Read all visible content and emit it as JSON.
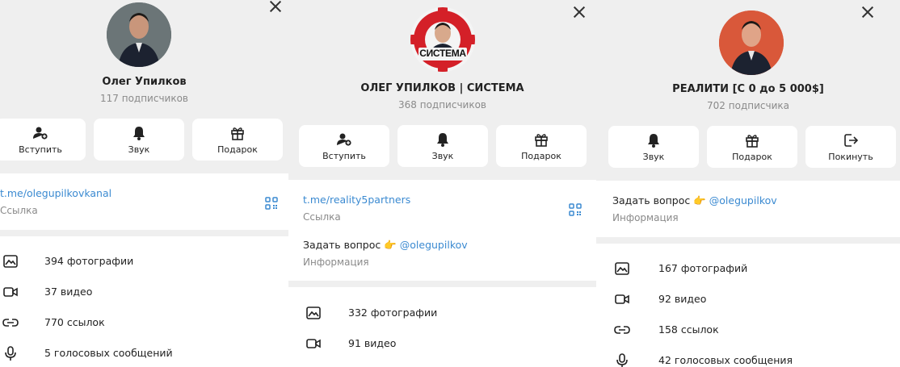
{
  "colors": {
    "accent": "#3b8ad1",
    "header_bg": "#efefef",
    "muted": "#8a8a8a"
  },
  "panel1": {
    "title": "Олег Упилков",
    "subscribers": "117 подписчиков",
    "buttons": [
      "Вступить",
      "Звук",
      "Подарок"
    ],
    "link": "t.me/olegupilkovkanal",
    "link_caption": "Ссылка",
    "media": [
      "394 фотографии",
      "37 видео",
      "770 ссылок",
      "5 голосовых сообщений"
    ]
  },
  "panel2": {
    "title": "ОЛЕГ УПИЛКОВ | СИСТЕМА",
    "avatar_badge": "СИСТЕМА",
    "subscribers": "368 подписчиков",
    "buttons": [
      "Вступить",
      "Звук",
      "Подарок"
    ],
    "link": "t.me/reality5partners",
    "link_caption": "Ссылка",
    "info_text": "Задать вопрос 👉 ",
    "info_mention": "@olegupilkov",
    "info_caption": "Информация",
    "media": [
      "332 фотографии",
      "91 видео"
    ]
  },
  "panel3": {
    "title": "РЕАЛИТИ [С 0 до 5 000$]",
    "subscribers": "702 подписчика",
    "buttons": [
      "Звук",
      "Подарок",
      "Покинуть"
    ],
    "info_text": "Задать вопрос 👉 ",
    "info_mention": "@olegupilkov",
    "info_caption": "Информация",
    "media": [
      "167 фотографий",
      "92 видео",
      "158 ссылок",
      "42 голосовых сообщения"
    ]
  }
}
